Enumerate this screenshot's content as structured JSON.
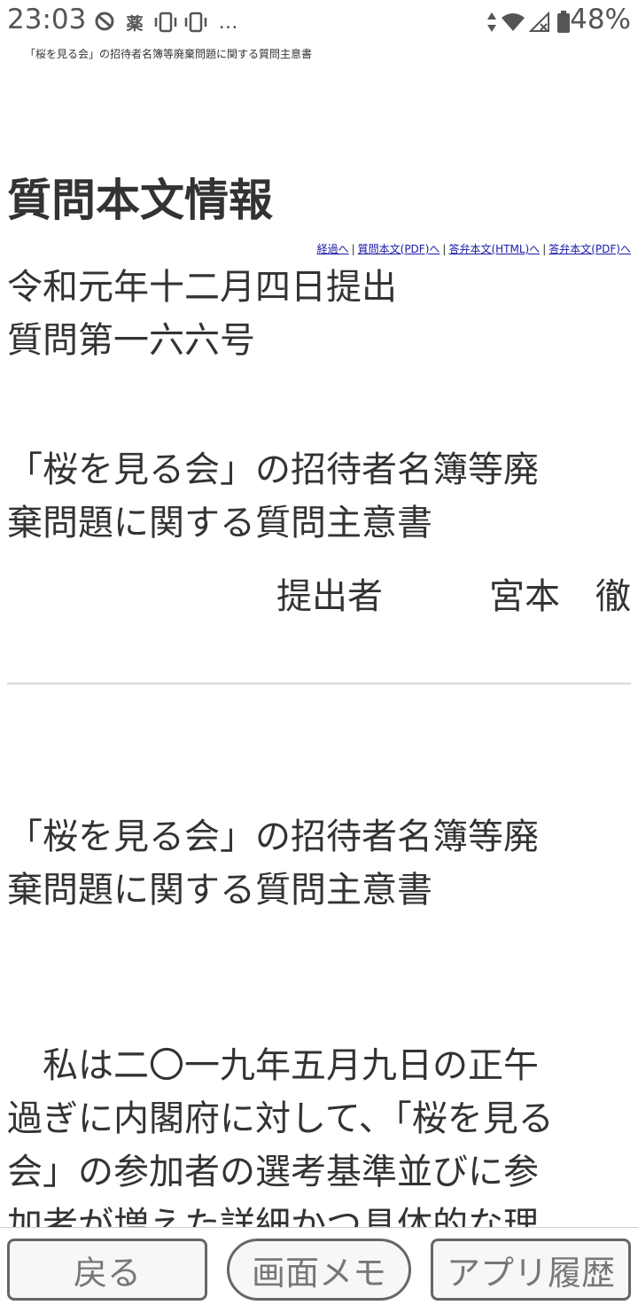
{
  "status_bar": {
    "time": "23:03",
    "notif_text": "薬",
    "more": "…",
    "battery": "48%"
  },
  "page": {
    "small_title": "「桜を見る会」の招待者名簿等廃棄問題に関する質問主意書",
    "heading": "質問本文情報",
    "links": [
      {
        "label": "経過へ"
      },
      {
        "label": "質問本文(PDF)へ"
      },
      {
        "label": "答弁本文(HTML)へ"
      },
      {
        "label": "答弁本文(PDF)へ"
      }
    ],
    "separator": "|",
    "date_line": "令和元年十二月四日提出",
    "number_line": "質問第一六六号",
    "title_lines": [
      "「桜を見る会」の招待者名簿等廃",
      "棄問題に関する質問主意書"
    ],
    "submitter": "提出者　　　宮本　徹",
    "title2_lines": [
      "「桜を見る会」の招待者名簿等廃",
      "棄問題に関する質問主意書"
    ],
    "body_lines": [
      "　私は二〇一九年五月九日の正午",
      "過ぎに内閣府に対して、「桜を見る",
      "会」の参加者の選考基準並びに参",
      "加者が増えた詳細かつ具体的な理"
    ]
  },
  "bottom_bar": {
    "back": "戻る",
    "memo": "画面メモ",
    "history": "アプリ履歴"
  }
}
